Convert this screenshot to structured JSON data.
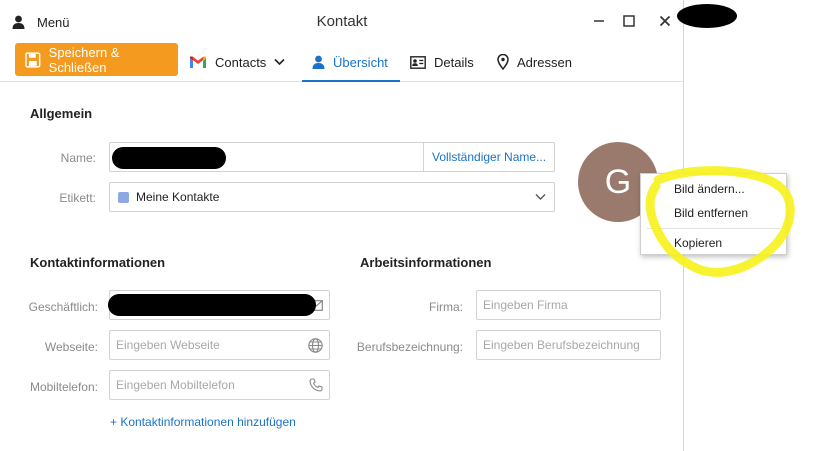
{
  "titlebar": {
    "menu_label": "Menü",
    "window_title": "Kontakt",
    "icons": {
      "menu": "person-icon",
      "minimize": "minimize-icon",
      "maximize": "maximize-icon",
      "close": "close-icon"
    }
  },
  "toolbar": {
    "save_label": "Speichern & Schließen",
    "tabs": [
      {
        "label": "Contacts",
        "icon": "gmail-icon"
      },
      {
        "label": "Übersicht",
        "icon": "person-icon",
        "active": true
      },
      {
        "label": "Details",
        "icon": "id-card-icon"
      },
      {
        "label": "Adressen",
        "icon": "location-pin-icon"
      }
    ]
  },
  "general": {
    "title": "Allgemein",
    "name_label": "Name:",
    "name_value": "",
    "fullname_link": "Vollständiger Name...",
    "tag_label": "Etikett:",
    "tag_value": "Meine Kontakte",
    "tag_color": "#8ea8e6"
  },
  "avatar": {
    "initial": "G",
    "color": "#9a7a6c"
  },
  "context_menu": {
    "items": [
      "Bild ändern...",
      "Bild entfernen",
      "Kopieren"
    ]
  },
  "contact_info": {
    "title": "Kontaktinformationen",
    "fields": [
      {
        "label": "Geschäftlich:",
        "value": "",
        "placeholder": "",
        "icon": "mail-icon"
      },
      {
        "label": "Webseite:",
        "value": "",
        "placeholder": "Eingeben Webseite",
        "icon": "globe-icon"
      },
      {
        "label": "Mobiltelefon:",
        "value": "",
        "placeholder": "Eingeben Mobiltelefon",
        "icon": "phone-icon"
      }
    ],
    "add_link": "+ Kontaktinformationen hinzufügen"
  },
  "work_info": {
    "title": "Arbeitsinformationen",
    "fields": [
      {
        "label": "Firma:",
        "placeholder": "Eingeben Firma"
      },
      {
        "label": "Berufsbezeichnung:",
        "placeholder": "Eingeben Berufsbezeichnung"
      }
    ]
  },
  "colors": {
    "accent": "#1a73c8",
    "save_button": "#f49a1e",
    "highlight": "#f7f21b"
  }
}
